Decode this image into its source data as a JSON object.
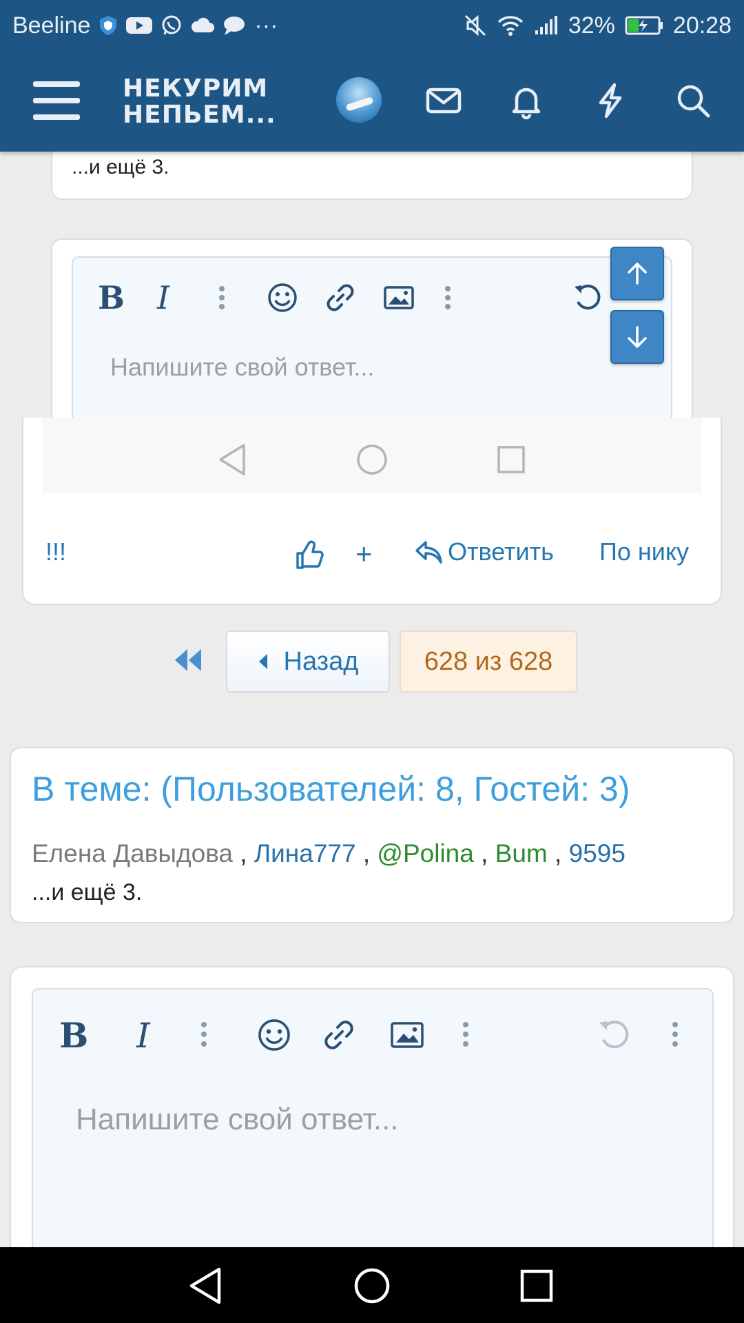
{
  "status_bar": {
    "carrier": "Beeline",
    "battery": "32%",
    "time": "20:28",
    "more_indicator": "···"
  },
  "header": {
    "logo_line1": "НЕКУРИМ",
    "logo_line2": "НЕПЬЕМ..."
  },
  "top_card": {
    "more_text": "...и ещё 3."
  },
  "editor_top": {
    "placeholder": "Напишите свой ответ..."
  },
  "post_actions": {
    "exclaim": "!!!",
    "plus": "+",
    "reply": "Ответить",
    "by_nick": "По нику"
  },
  "pagination": {
    "back": "Назад",
    "current": "628 из 628"
  },
  "online": {
    "title": "В теме: (Пользователей: 8, Гостей: 3)",
    "users": [
      {
        "name": "Елена Давыдова",
        "color": "#7a7a7a"
      },
      {
        "name": "Лина777",
        "color": "#2a6fa8"
      },
      {
        "name": "@Polina",
        "color": "#2d8a2d"
      },
      {
        "name": "Bum",
        "color": "#2d8a2d"
      },
      {
        "name": "9595",
        "color": "#2a6fa8"
      }
    ],
    "separator": ",",
    "more_text": "...и ещё 3."
  },
  "editor_bottom": {
    "placeholder": "Напишите свой ответ..."
  },
  "colors": {
    "header_bg": "#1d5585",
    "link": "#2577b1",
    "accent_title": "#3f9fdc",
    "current_page": "#b06a1a"
  }
}
